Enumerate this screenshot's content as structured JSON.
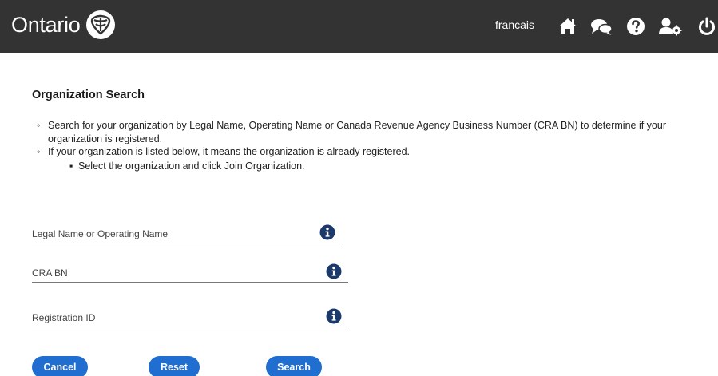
{
  "header": {
    "brand": "Ontario",
    "language_link": "francais",
    "icons": [
      "home-icon",
      "chat-icon",
      "help-icon",
      "user-settings-icon",
      "power-icon"
    ],
    "colors": {
      "bar": "#333333",
      "icon": "#ffffff"
    }
  },
  "main": {
    "title": "Organization Search",
    "instructions": [
      "Search for your organization by Legal Name, Operating Name or Canada Revenue Agency Business Number (CRA BN) to determine if your organization is registered.",
      "If your organization is listed below, it means the organization is already registered."
    ],
    "sub_instruction": "Select the organization and click Join Organization.",
    "fields": [
      {
        "label": "Legal Name or Operating Name",
        "value": ""
      },
      {
        "label": "CRA BN",
        "value": ""
      },
      {
        "label": "Registration ID",
        "value": ""
      }
    ]
  },
  "buttons": {
    "cancel": "Cancel",
    "reset": "Reset",
    "search": "Search"
  },
  "colors": {
    "button": "#1f6ed0",
    "info_icon": "#1b3a6b"
  }
}
